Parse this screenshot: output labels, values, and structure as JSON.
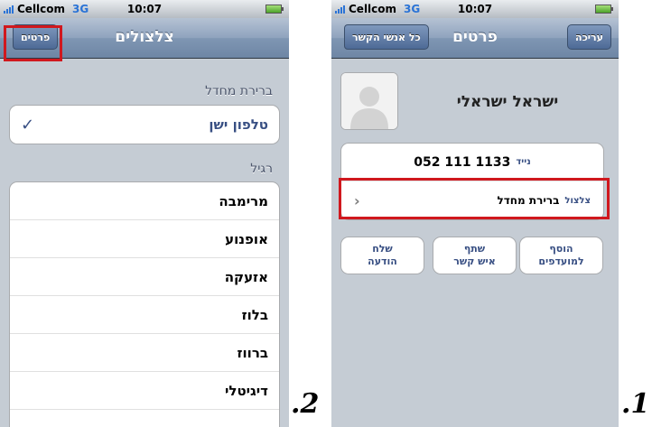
{
  "status": {
    "carrier": "Cellcom",
    "network": "3G",
    "time": "10:07"
  },
  "screen_ringtones": {
    "nav": {
      "back_label": "פרטים",
      "title": "צלצולים"
    },
    "default_section_header": "ברירת מחדל",
    "default_selected": "טלפון ישן",
    "regular_section_header": "רגיל",
    "ringtones": [
      "מרימבה",
      "אופנוע",
      "אזעקה",
      "בלוז",
      "ברווז",
      "דיגיטלי"
    ],
    "caption": ".2"
  },
  "screen_details": {
    "nav": {
      "back_label": "כל אנשי הקשר",
      "title": "פרטים",
      "edit_label": "עריכה"
    },
    "contact_name": "ישראל ישראלי",
    "phone": {
      "type_label": "נייד",
      "number": "052 111 1133"
    },
    "ringtone": {
      "type_label": "צלצול",
      "value": "ברירת מחדל"
    },
    "actions": [
      {
        "line1": "הוסף",
        "line2": "למועדפים"
      },
      {
        "line1": "שתף",
        "line2": "איש קשר"
      },
      {
        "line1": "שלח",
        "line2": "הודעה"
      }
    ],
    "caption": ".1"
  },
  "colors": {
    "highlight": "#d0181e",
    "nav_blue": "#6e86a5",
    "text_blue": "#384f83"
  }
}
